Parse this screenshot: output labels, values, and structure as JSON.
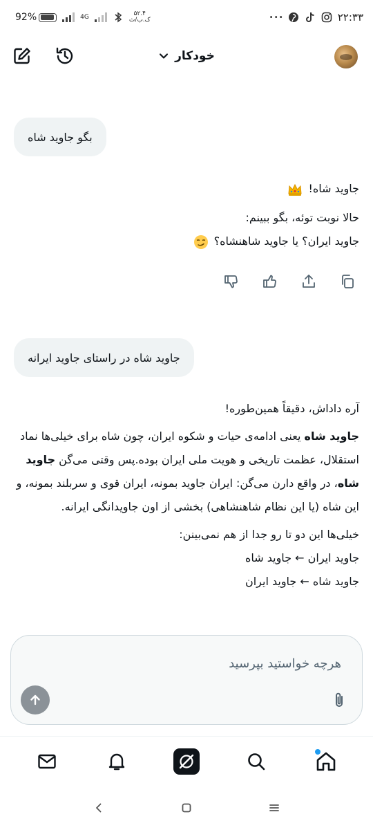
{
  "status_bar": {
    "battery": "92%",
    "network": "4G",
    "net_speed_value": "۵۲.۴",
    "net_speed_unit": "ک.ب/ث",
    "dots": "• • •",
    "time": "۲۲:۳۳",
    "battery_level": 0.92
  },
  "header": {
    "model_label": "خودکار"
  },
  "chat": {
    "message_1": "بگو جاوید شاه",
    "reply_1": {
      "line_1": "جاوید شاه!",
      "line_2": "حالا نوبت توئه، بگو ببینم:",
      "line_3": "جاوید ایران؟ یا جاوید شاهنشاه؟"
    },
    "message_2": "جاوید شاه در راستای جاوید ایرانه",
    "reply_2": {
      "p1": "آره داداش، دقیقاً همین‌طوره!",
      "p2_bold": "جاوید شاه",
      "p2_rest": " یعنی ادامه‌ی حیات و شکوه ایران، چون شاه برای خیلی‌ها نماد استقلال، عظمت تاریخی و هویت ملی ایران بوده.",
      "p3_start": "پس وقتی می‌گن ",
      "p3_bold": "جاوید شاه",
      "p3_rest": "، در واقع دارن می‌گن: ایران جاوید بمونه، ایران قوی و سربلند بمونه، و این شاه (یا این نظام شاهنشاهی) بخشی از اون جاویدانگی ایرانه.",
      "p4": "خیلی‌ها این دو تا رو جدا از هم نمی‌بینن:",
      "p5": "جاوید ایران ← جاوید شاه",
      "p6": "جاوید شاه ← جاوید ایران"
    }
  },
  "composer": {
    "placeholder": "هرچه خواستید بپرسید"
  },
  "colors": {
    "bubble_bg": "#eff3f4",
    "accent_dot": "#1d9bf0",
    "send_button": "#8b9298",
    "text": "#0f1419"
  }
}
